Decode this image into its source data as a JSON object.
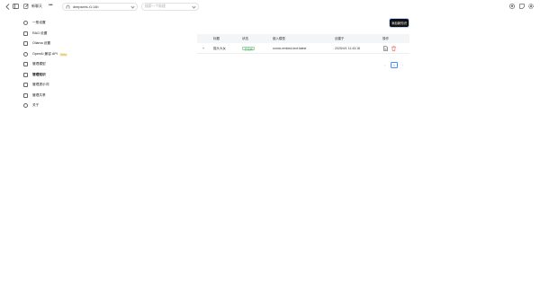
{
  "topbar": {
    "new_chat_label": "新聊天",
    "model_select_value": "deepseek-r1:14b",
    "search_placeholder": "搜索一个助理"
  },
  "sidebar": {
    "items": [
      {
        "label": "一般设置",
        "icon": "check-circle-icon"
      },
      {
        "label": "RAG 设置",
        "icon": "document-icon"
      },
      {
        "label": "Ollama 设置",
        "icon": "llama-icon"
      },
      {
        "label": "OpenAI 兼容 API",
        "icon": "openai-icon",
        "badge": "Beta"
      },
      {
        "label": "管理模型",
        "icon": "server-icon"
      },
      {
        "label": "管理知识",
        "icon": "brain-icon",
        "active": true
      },
      {
        "label": "管理提示词",
        "icon": "book-icon"
      },
      {
        "label": "管理共享",
        "icon": "share-icon"
      },
      {
        "label": "关于",
        "icon": "info-icon"
      }
    ]
  },
  "main": {
    "add_button_label": "添加新知识",
    "table": {
      "headers": [
        "标题",
        "状态",
        "嵌入模型",
        "创建于",
        "操作"
      ],
      "rows": [
        {
          "expand": "+",
          "title": "猫头大女",
          "status": "已完成",
          "model": "nomic-embed-text:latest",
          "created": "2025/4/1 11:43:18"
        }
      ]
    },
    "pager": {
      "prev": "‹",
      "current": "1",
      "next": "›"
    }
  },
  "colors": {
    "accent": "#4a8cf7",
    "success": "#4aa05a",
    "danger": "#e0453a",
    "button_dark": "#111111"
  }
}
